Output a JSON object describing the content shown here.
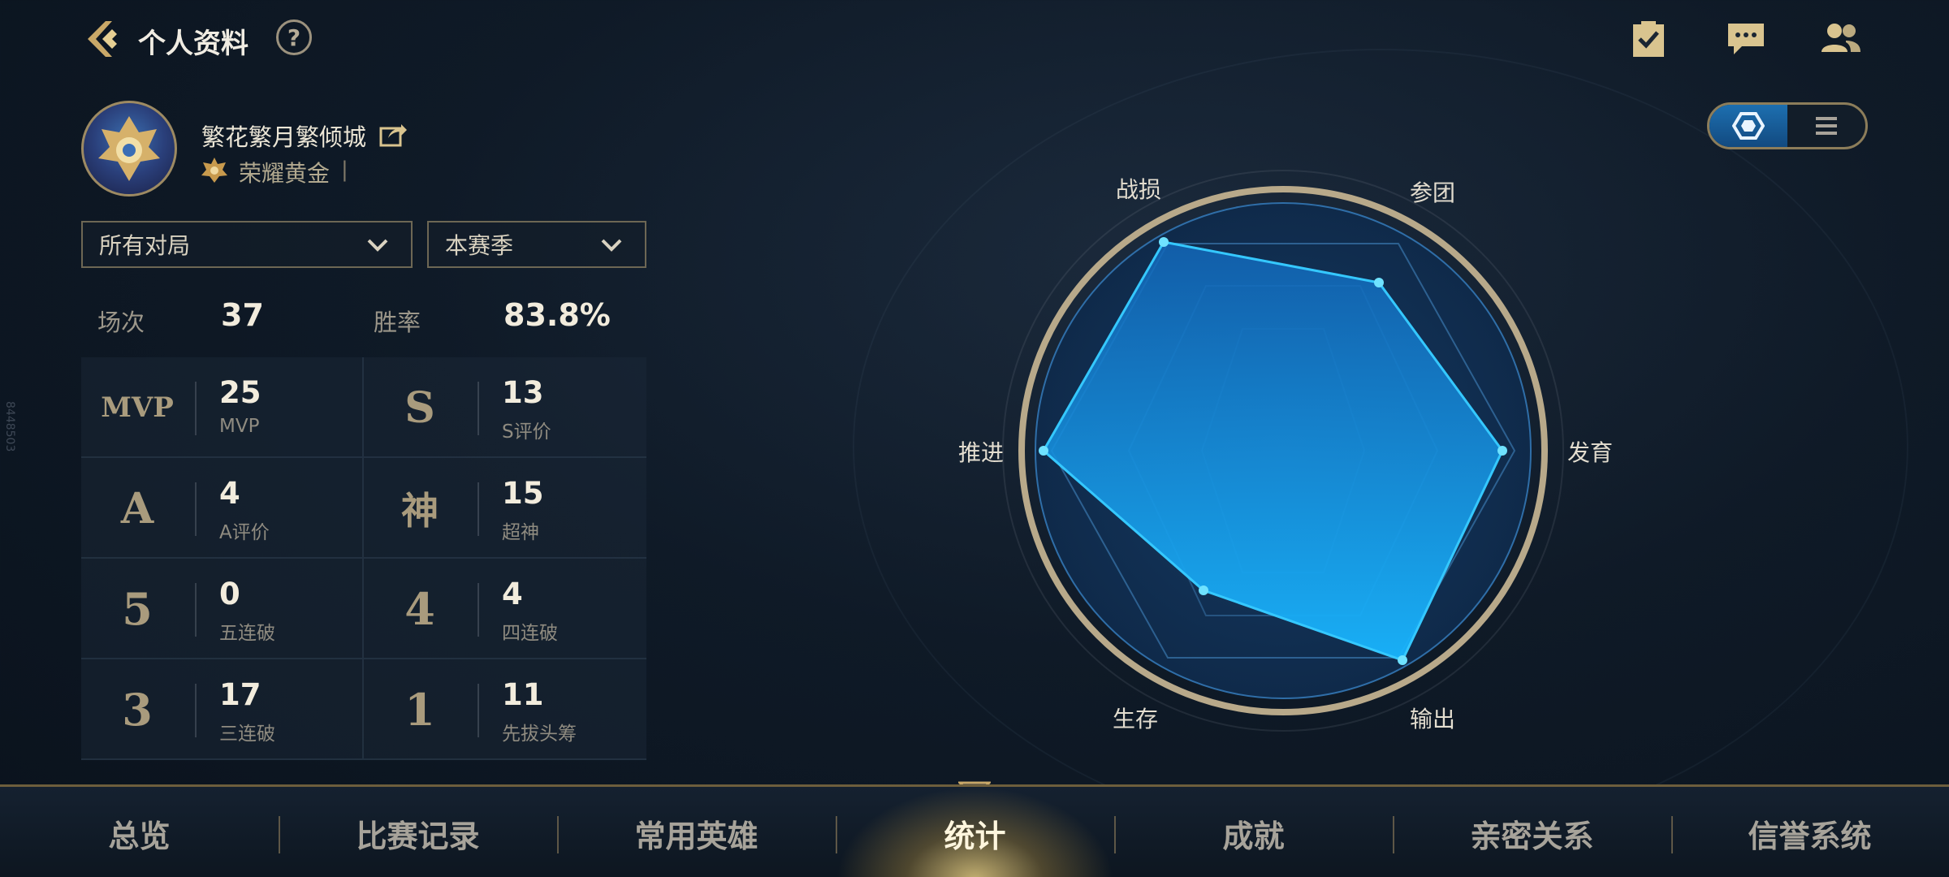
{
  "header": {
    "title": "个人资料",
    "help_label": "?"
  },
  "profile": {
    "name": "繁花繁月繁倾城",
    "rank": "荣耀黄金",
    "rank_separator": "|"
  },
  "filters": {
    "mode": "所有对局",
    "season": "本赛季"
  },
  "summary": {
    "games_label": "场次",
    "games_value": "37",
    "winrate_label": "胜率",
    "winrate_value": "83.8%"
  },
  "stats": [
    {
      "badge": "MVP",
      "value": "25",
      "label": "MVP"
    },
    {
      "badge": "S",
      "value": "13",
      "label": "S评价"
    },
    {
      "badge": "A",
      "value": "4",
      "label": "A评价"
    },
    {
      "badge": "神",
      "value": "15",
      "label": "超神"
    },
    {
      "badge": "5",
      "value": "0",
      "label": "五连破"
    },
    {
      "badge": "4",
      "value": "4",
      "label": "四连破"
    },
    {
      "badge": "3",
      "value": "17",
      "label": "三连破"
    },
    {
      "badge": "1",
      "value": "11",
      "label": "先拔头筹"
    }
  ],
  "radar": {
    "labels": [
      "战损",
      "参团",
      "发育",
      "输出",
      "生存",
      "推进"
    ]
  },
  "side_code": "8448503",
  "nav": {
    "tabs": [
      "总览",
      "比赛记录",
      "常用英雄",
      "统计",
      "成就",
      "亲密关系",
      "信誉系统"
    ],
    "active_index": 3
  },
  "colors": {
    "accent_gold": "#c9a868",
    "radar_fill": "#1a8fe0",
    "radar_stroke": "#35c8ff"
  },
  "icons": {
    "top_right": [
      "task-check-icon",
      "chat-icon",
      "friends-icon"
    ]
  }
}
